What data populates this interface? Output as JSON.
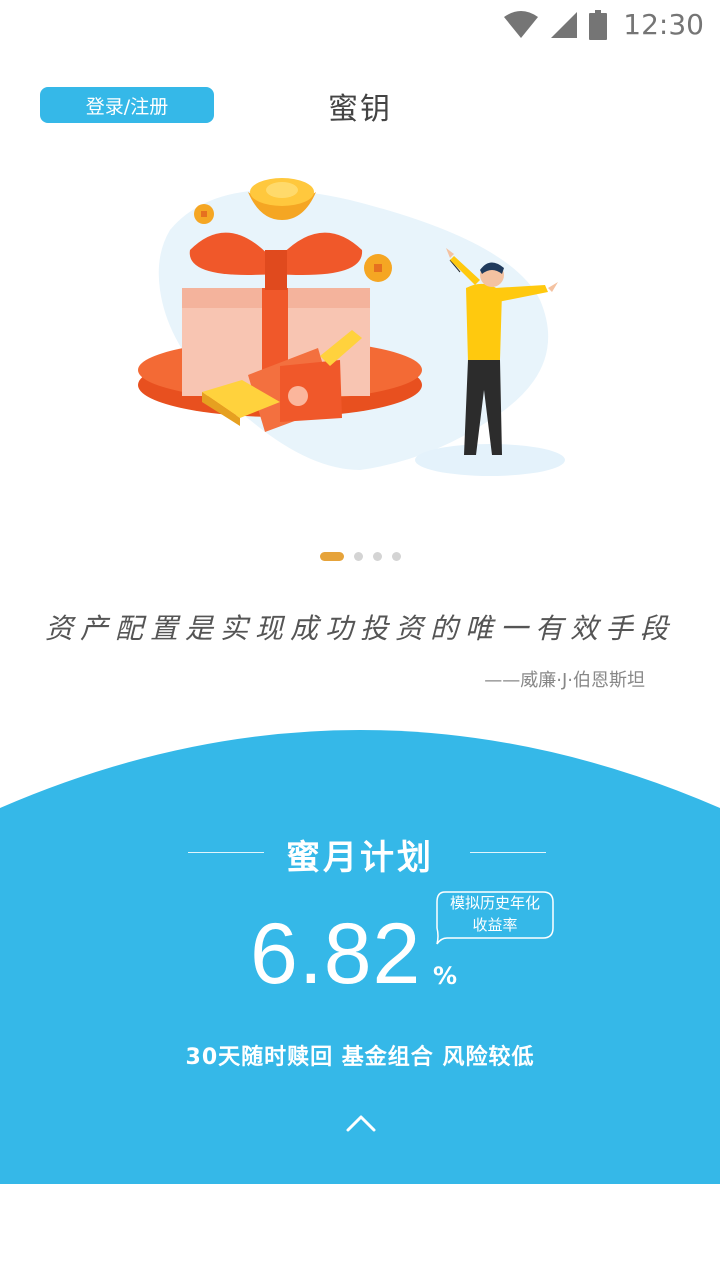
{
  "status_bar": {
    "time": "12:30",
    "icons": [
      "wifi-icon",
      "cellular-signal-icon",
      "battery-icon"
    ]
  },
  "header": {
    "login_label": "登录/注册",
    "title": "蜜钥"
  },
  "carousel": {
    "dot_count": 4,
    "active_index": 0
  },
  "quote": {
    "text": "资产配置是实现成功投资的唯一有效手段",
    "author": "——威廉·J·伯恩斯坦"
  },
  "plan": {
    "title": "蜜月计划",
    "rate": "6.82",
    "rate_unit": "%",
    "rate_label_line1": "模拟历史年化",
    "rate_label_line2": "收益率",
    "features": "30天随时赎回 基金组合 风险较低"
  },
  "colors": {
    "primary_blue": "#35b8e8",
    "dot_active": "#e6a33a",
    "dot_inactive": "#d4d4d4",
    "gift_orange": "#f0582a"
  }
}
